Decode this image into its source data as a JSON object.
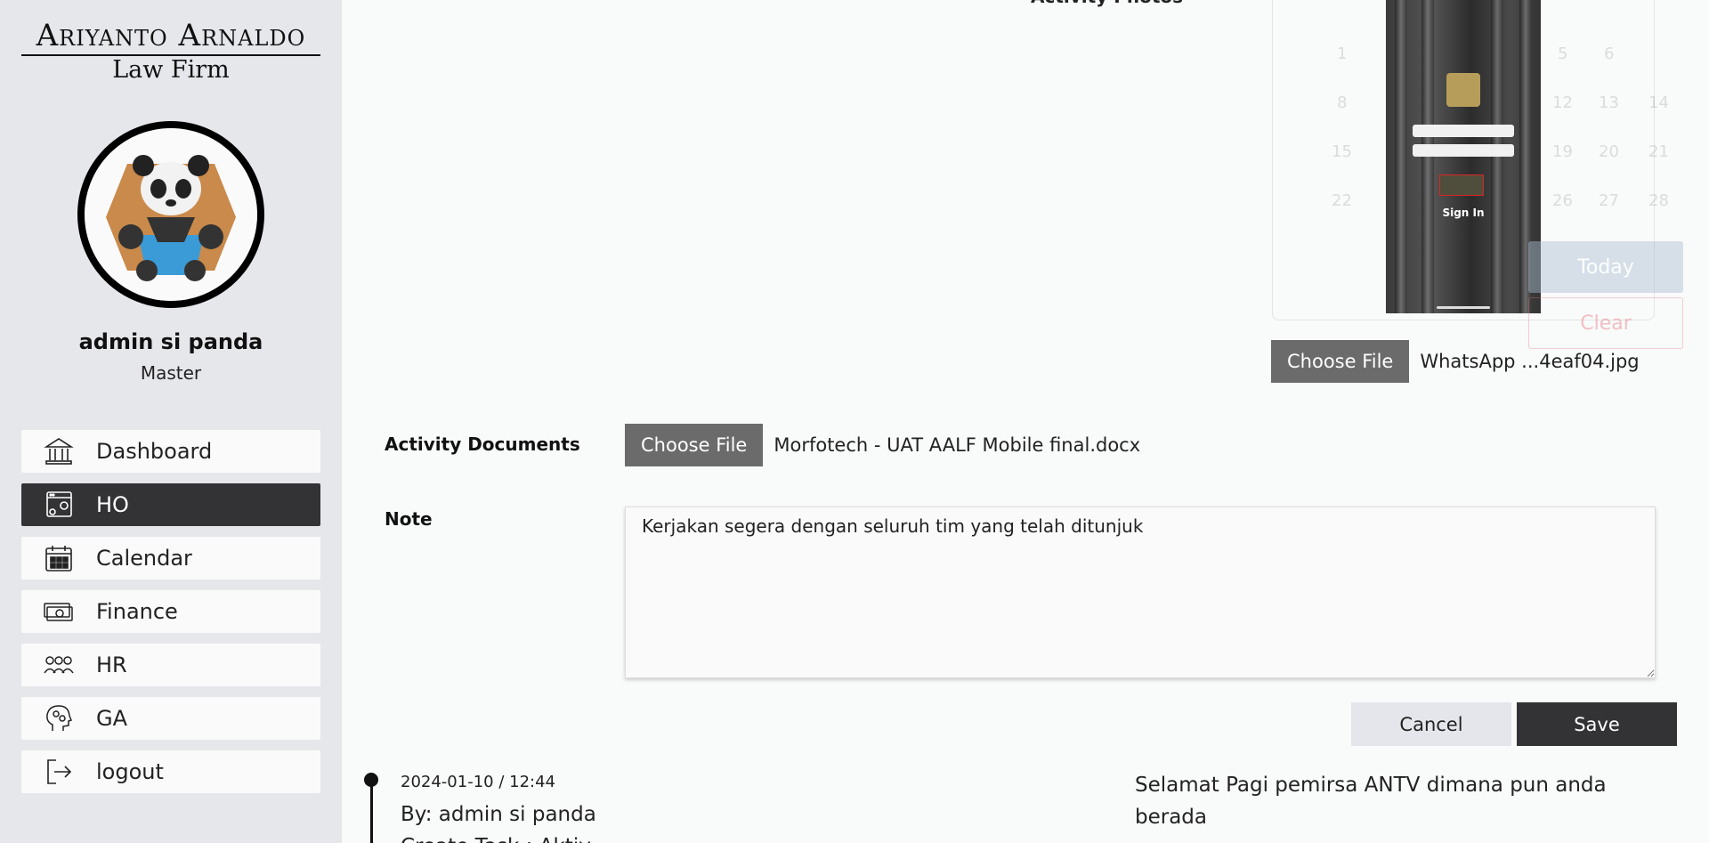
{
  "logo": {
    "line1": "Ariyanto Arnaldo",
    "line2": "Law Firm"
  },
  "user": {
    "name": "admin si panda",
    "role": "Master"
  },
  "nav": [
    {
      "label": "Dashboard",
      "icon": "bank-icon"
    },
    {
      "label": "HO",
      "icon": "settings-window-icon",
      "active": true
    },
    {
      "label": "Calendar",
      "icon": "calendar-icon"
    },
    {
      "label": "Finance",
      "icon": "money-icon"
    },
    {
      "label": "HR",
      "icon": "people-icon"
    },
    {
      "label": "GA",
      "icon": "head-gears-icon"
    },
    {
      "label": "logout",
      "icon": "logout-icon"
    }
  ],
  "form": {
    "photos_label": "Activity Photos",
    "photos_button": "Choose File",
    "photos_file": "WhatsApp ...4eaf04.jpg",
    "documents_label": "Activity Documents",
    "documents_button": "Choose File",
    "documents_file": "Morfotech - UAT AALF Mobile final.docx",
    "note_label": "Note",
    "note_value": "Kerjakan segera dengan seluruh tim yang telah ditunjuk",
    "cancel": "Cancel",
    "save": "Save"
  },
  "preview": {
    "sign_in": "Sign In"
  },
  "calendar_overlay": {
    "today": "Today",
    "clear": "Clear"
  },
  "timeline": {
    "date": "2024-01-10 / 12:44",
    "by": "By: admin si panda",
    "cut_text": "Create Task : Aktiv",
    "message": "Selamat Pagi pemirsa ANTV dimana pun anda berada"
  },
  "colors": {
    "sidebar_bg": "#e6e7eb",
    "active_nav": "#333336",
    "save_bg": "#333336",
    "choose_btn": "#6b6b6b"
  }
}
